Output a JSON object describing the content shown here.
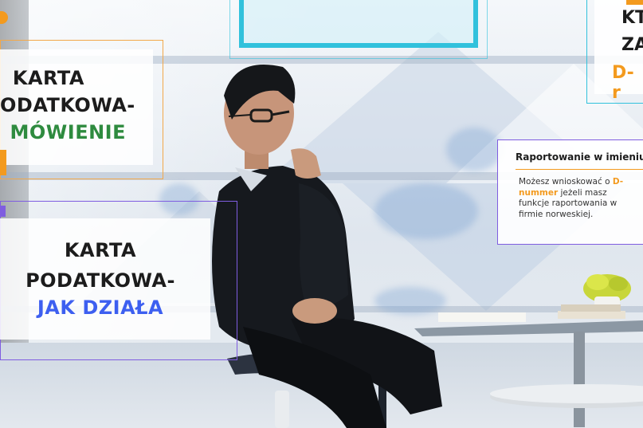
{
  "card_order": {
    "line1": "KARTA",
    "line2": "ODATKOWA-",
    "line3": "MÓWIENIE"
  },
  "card_how": {
    "line1": "KARTA",
    "line2": "PODATKOWA-",
    "line3": "JAK DZIAŁA"
  },
  "card_top_right": {
    "line1": "KT",
    "line2": "ZA",
    "line3": "D-r"
  },
  "card_reporting": {
    "title": "Raportowanie w imieniu",
    "text_before": "Możesz wnioskować o ",
    "highlight": "D-nummer",
    "text_after": " jeżeli masz funkcje raportowania w firmie norweskiej."
  },
  "colors": {
    "orange_accent": "#f39a1e",
    "green_text": "#2e8b3f",
    "blue_text": "#3d5ff0",
    "purple_frame": "#7f5de0",
    "cyan_frame": "#31c1dc"
  }
}
